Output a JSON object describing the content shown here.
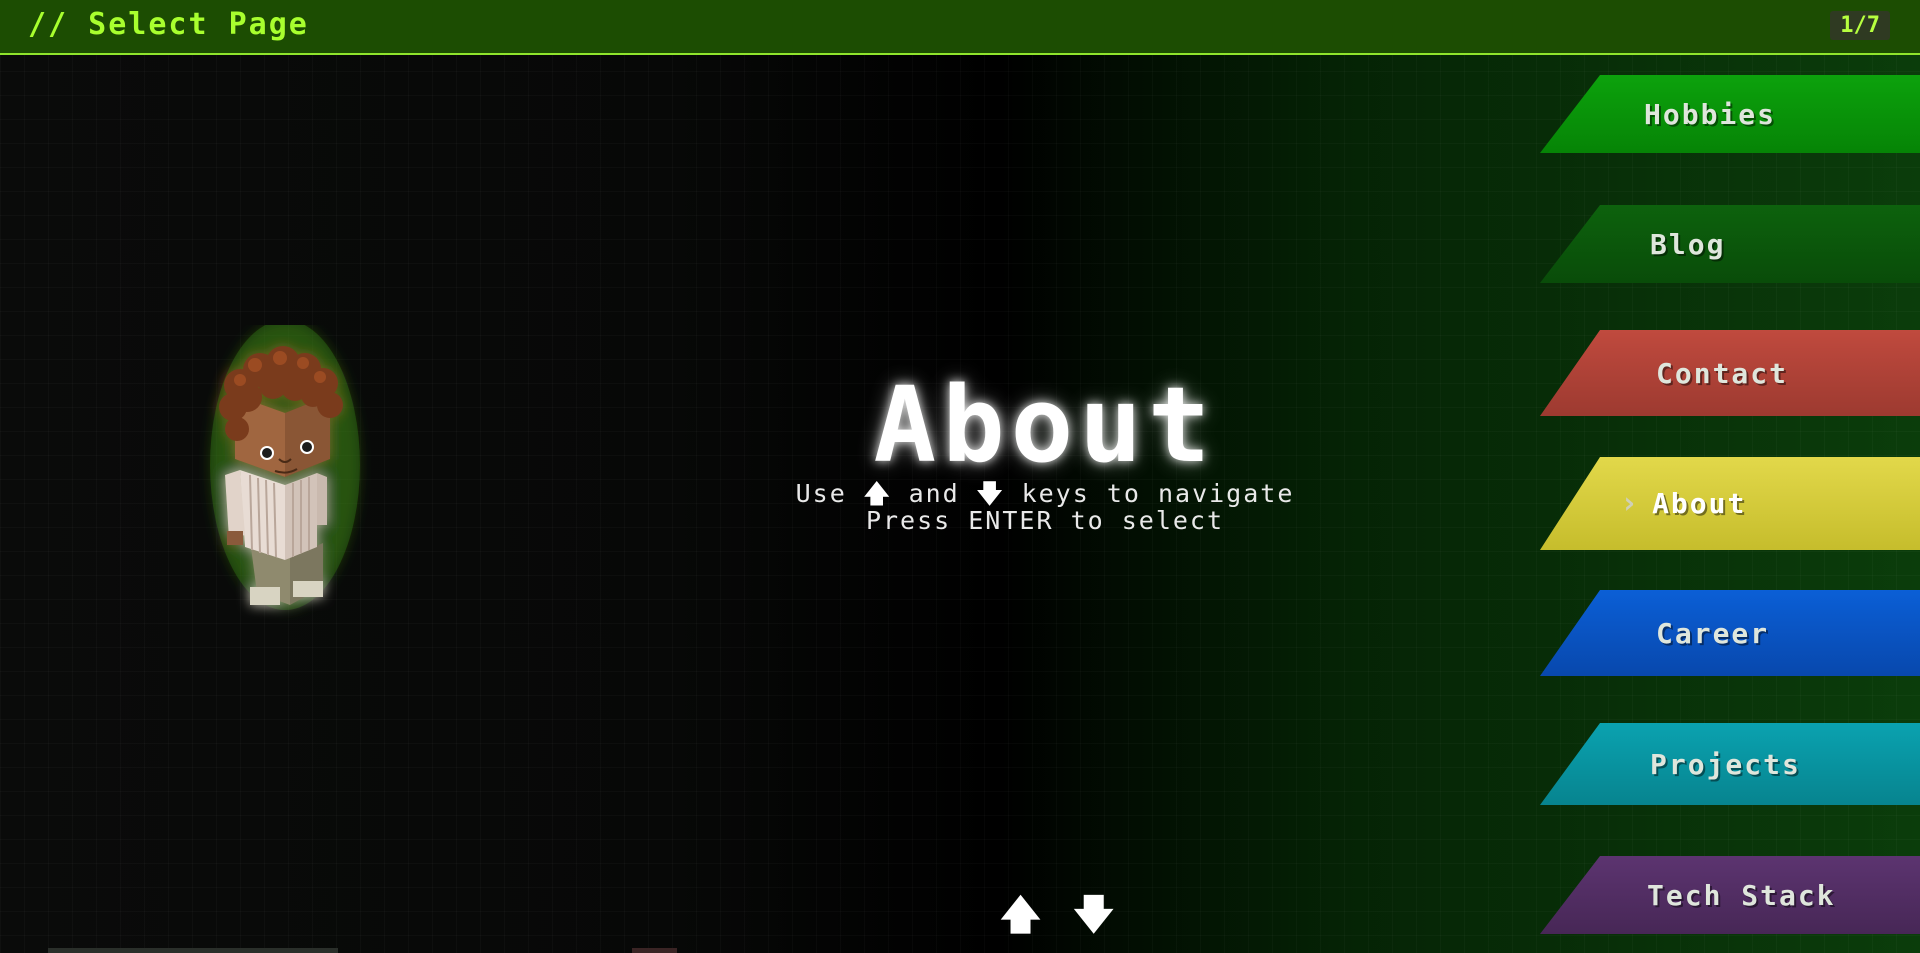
{
  "topbar": {
    "title": "// Select Page",
    "page_counter": "1/7"
  },
  "colors": {
    "accent": "#a8ff2e",
    "topbar_bg": "#1c4d02",
    "hobbies": "#0a9a0a",
    "blog": "#0b5a0b",
    "contact": "#b3453a",
    "about": "#d6cf3a",
    "career": "#0a55c8",
    "projects": "#0a9aa8",
    "tech_stack": "#57306b"
  },
  "main": {
    "title": "About",
    "instruction_use": "Use",
    "instruction_up_arrow": "🡅",
    "instruction_and": "and",
    "instruction_down_arrow": "🡇",
    "instruction_rest": "keys to navigate",
    "instruction_line2": "Press ENTER to select"
  },
  "avatar": {
    "icon": "lego-minifigure-avatar"
  },
  "menu": {
    "items": [
      {
        "label": "Hobbies"
      },
      {
        "label": "Blog"
      },
      {
        "label": "Contact"
      },
      {
        "label": "About",
        "active": true,
        "chevron": "›"
      },
      {
        "label": "Career"
      },
      {
        "label": "Projects"
      },
      {
        "label": "Tech Stack"
      }
    ]
  },
  "nav_arrows": {
    "up": "🡅",
    "down": "🡇"
  }
}
